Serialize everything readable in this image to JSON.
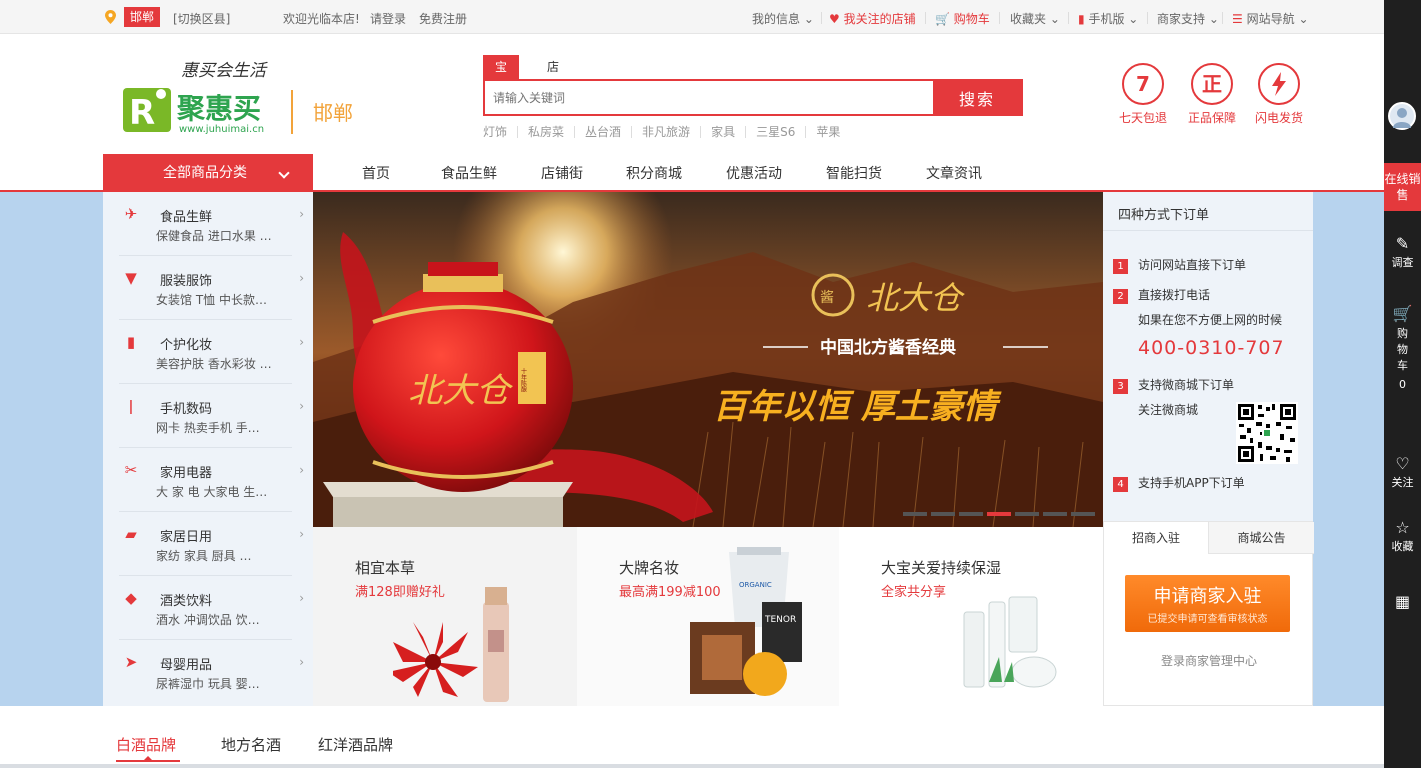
{
  "topbar": {
    "city": "邯郸",
    "switch": "[切换区县]",
    "welcome": "欢迎光临本店!",
    "login": "请登录",
    "register": "免费注册",
    "my_info": "我的信息",
    "followed_shops": "我关注的店铺",
    "cart": "购物车",
    "favorites": "收藏夹",
    "mobile": "手机版",
    "merchant_support": "商家支持",
    "site_nav": "网站导航"
  },
  "logo": {
    "slogan": "惠买会生活",
    "name": "聚惠买",
    "url": "www.juhuimai.cn",
    "city": "邯郸"
  },
  "search": {
    "tabs": [
      "宝贝",
      "店铺"
    ],
    "placeholder": "请输入关键词",
    "button": "搜索",
    "hotwords": [
      "灯饰",
      "私房菜",
      "丛台酒",
      "非凡旅游",
      "家具",
      "三星S6",
      "苹果"
    ]
  },
  "promises": [
    {
      "icon": "7",
      "label": "七天包退"
    },
    {
      "icon": "正",
      "label": "正品保障"
    },
    {
      "icon": "lightning-icon",
      "label": "闪电发货"
    }
  ],
  "nav": {
    "all_categories": "全部商品分类",
    "items": [
      "首页",
      "食品生鲜",
      "店铺街",
      "积分商城",
      "优惠活动",
      "智能扫货",
      "文章资讯"
    ]
  },
  "categories": [
    {
      "icon": "plane-icon",
      "title": "食品生鲜",
      "sub": "保健食品  进口水果 …"
    },
    {
      "icon": "cup-icon",
      "title": "服装服饰",
      "sub": "女装馆  T恤  中长款…"
    },
    {
      "icon": "bottle-icon",
      "title": "个护化妆",
      "sub": "美容护肤  香水彩妆 …"
    },
    {
      "icon": "phone-icon",
      "title": "手机数码",
      "sub": "网卡  热卖手机  手…"
    },
    {
      "icon": "scissors-icon",
      "title": "家用电器",
      "sub": "大 家 电  大家电  生…"
    },
    {
      "icon": "bucket-icon",
      "title": "家居日用",
      "sub": "家纺  家具  厨具 …"
    },
    {
      "icon": "tag-icon",
      "title": "酒类饮料",
      "sub": "酒水  冲调饮品  饮…"
    },
    {
      "icon": "fish-icon",
      "title": "母婴用品",
      "sub": "尿裤湿巾  玩具  婴…"
    }
  ],
  "banner": {
    "brand": "北大仓",
    "tagline": "中国北方酱香经典",
    "slogan": "百年以恒 厚土豪情",
    "jar_text": "北大仓",
    "jar_label": "十年陈酿",
    "slides": 7,
    "active_slide": 4
  },
  "promos": [
    {
      "title": "相宜本草",
      "sub": "满128即赠好礼"
    },
    {
      "title": "大牌名妆",
      "sub": "最高满199减100"
    },
    {
      "title": "大宝关爱持续保湿",
      "sub": "全家共分享"
    }
  ],
  "order": {
    "title": "四种方式下订单",
    "steps": [
      {
        "num": "1",
        "text": "访问网站直接下订单"
      },
      {
        "num": "2",
        "text": "直接拨打电话"
      },
      {
        "num": "3",
        "text": "支持微商城下订单"
      },
      {
        "num": "4",
        "text": "支持手机APP下订单"
      }
    ],
    "phone_note": "如果在您不方便上网的时候",
    "phone": "400-0310-707",
    "wechat_note": "关注微商城"
  },
  "merchant": {
    "tabs": [
      "招商入驻",
      "商城公告"
    ],
    "apply": "申请商家入驻",
    "apply_sub": "已提交申请可查看审核状态",
    "login": "登录商家管理中心"
  },
  "bottom_tabs": [
    "白酒品牌",
    "地方名酒",
    "红洋酒品牌"
  ],
  "toolbar": {
    "sale": "在线销售",
    "survey": "调查",
    "cart": "购物车",
    "cart_count": "0",
    "follow": "关注",
    "favorite": "收藏"
  },
  "colors": {
    "accent": "#e4393c",
    "orange": "#f06a0a",
    "panel": "#eef3f9",
    "bg_blue": "#b7d3ee"
  }
}
